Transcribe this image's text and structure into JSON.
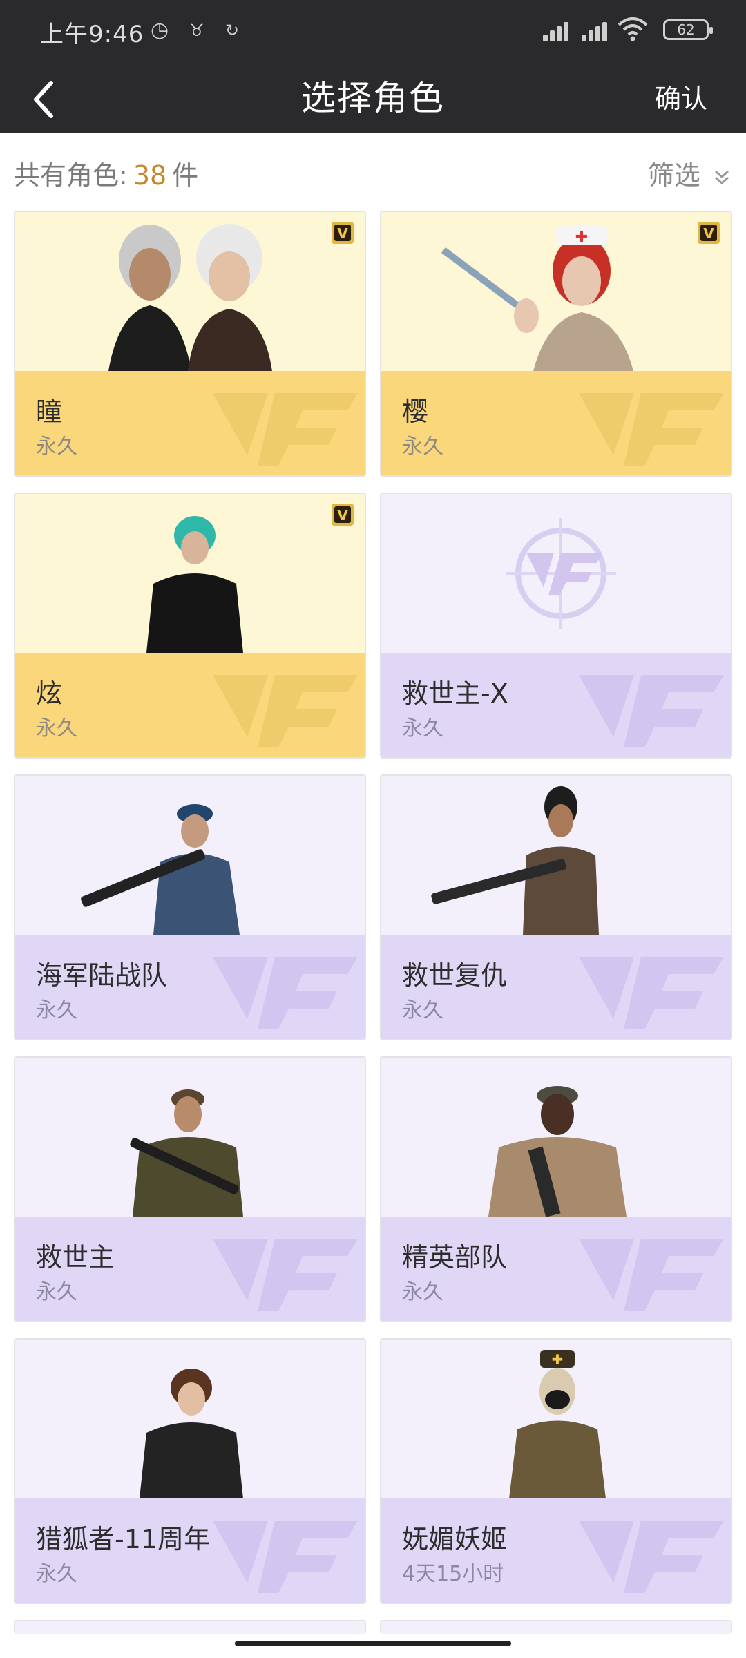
{
  "status_bar": {
    "time": "上午9:46",
    "battery": "62"
  },
  "header": {
    "title": "选择角色",
    "confirm_label": "确认"
  },
  "summary": {
    "prefix": "共有角色:",
    "count": "38",
    "unit": "件"
  },
  "filter": {
    "label": "筛选"
  },
  "cards": [
    {
      "name": "瞳",
      "duration": "永久",
      "tier": "gold",
      "vip": true
    },
    {
      "name": "樱",
      "duration": "永久",
      "tier": "gold",
      "vip": true
    },
    {
      "name": "炫",
      "duration": "永久",
      "tier": "gold",
      "vip": true
    },
    {
      "name": "救世主-X",
      "duration": "永久",
      "tier": "purple",
      "vip": false
    },
    {
      "name": "海军陆战队",
      "duration": "永久",
      "tier": "purple",
      "vip": false
    },
    {
      "name": "救世复仇",
      "duration": "永久",
      "tier": "purple",
      "vip": false
    },
    {
      "name": "救世主",
      "duration": "永久",
      "tier": "purple",
      "vip": false
    },
    {
      "name": "精英部队",
      "duration": "永久",
      "tier": "purple",
      "vip": false
    },
    {
      "name": "猎狐者-11周年",
      "duration": "永久",
      "tier": "purple",
      "vip": false
    },
    {
      "name": "妩媚妖姬",
      "duration": "4天15小时",
      "tier": "purple",
      "vip": false
    }
  ],
  "colors": {
    "count_accent": "#c6862b",
    "gold_top": "#fef7d6",
    "gold_bottom": "#f9d77a",
    "purple_top": "#f3f0fc",
    "purple_bottom": "#e0d6f6"
  },
  "icons": [
    "back-arrow-icon",
    "filter-chevron-icon",
    "vip-badge-icon",
    "cf-watermark-icon",
    "wifi-icon",
    "signal-icon",
    "alarm-icon"
  ]
}
